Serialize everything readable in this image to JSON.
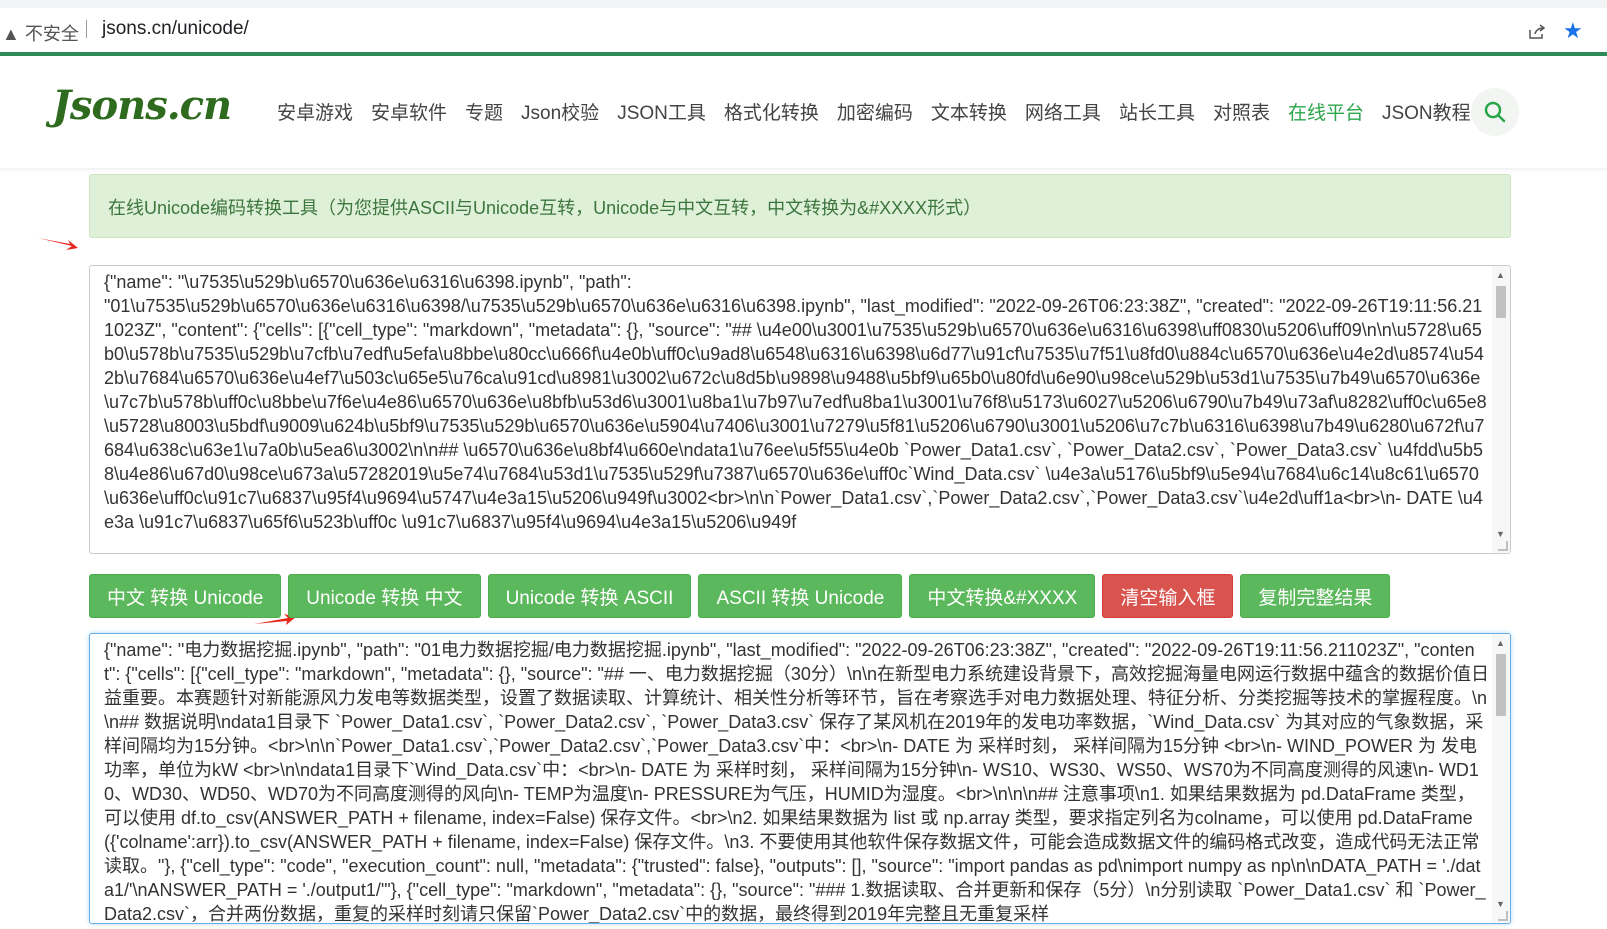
{
  "browser": {
    "security_label": "不安全",
    "url": "jsons.cn/unicode/"
  },
  "colors": {
    "brand_green": "#2e8b57",
    "button_green": "#5cb85c",
    "button_red": "#d9534f",
    "arrow_red": "#e8251b"
  },
  "site": {
    "logo": "Jsons.cn",
    "nav": [
      {
        "label": "安卓游戏",
        "active": false
      },
      {
        "label": "安卓软件",
        "active": false
      },
      {
        "label": "专题",
        "active": false
      },
      {
        "label": "Json校验",
        "active": false
      },
      {
        "label": "JSON工具",
        "active": false
      },
      {
        "label": "格式化转换",
        "active": false
      },
      {
        "label": "加密编码",
        "active": false
      },
      {
        "label": "文本转换",
        "active": false
      },
      {
        "label": "网络工具",
        "active": false
      },
      {
        "label": "站长工具",
        "active": false
      },
      {
        "label": "对照表",
        "active": false
      },
      {
        "label": "在线平台",
        "active": true
      },
      {
        "label": "JSON教程",
        "active": false
      }
    ],
    "search_icon": "search-icon"
  },
  "main": {
    "info": "在线Unicode编码转换工具（为您提供ASCII与Unicode互转，Unicode与中文互转，中文转换为&#XXXX形式）",
    "input_text": "{\"name\": \"\\u7535\\u529b\\u6570\\u636e\\u6316\\u6398.ipynb\", \"path\":\n\"01\\u7535\\u529b\\u6570\\u636e\\u6316\\u6398/\\u7535\\u529b\\u6570\\u636e\\u6316\\u6398.ipynb\", \"last_modified\": \"2022-09-26T06:23:38Z\", \"created\": \"2022-09-26T19:11:56.211023Z\", \"content\": {\"cells\": [{\"cell_type\": \"markdown\", \"metadata\": {}, \"source\": \"## \\u4e00\\u3001\\u7535\\u529b\\u6570\\u636e\\u6316\\u6398\\uff0830\\u5206\\uff09\\n\\n\\u5728\\u65b0\\u578b\\u7535\\u529b\\u7cfb\\u7edf\\u5efa\\u8bbe\\u80cc\\u666f\\u4e0b\\uff0c\\u9ad8\\u6548\\u6316\\u6398\\u6d77\\u91cf\\u7535\\u7f51\\u8fd0\\u884c\\u6570\\u636e\\u4e2d\\u8574\\u542b\\u7684\\u6570\\u636e\\u4ef7\\u503c\\u65e5\\u76ca\\u91cd\\u8981\\u3002\\u672c\\u8d5b\\u9898\\u9488\\u5bf9\\u65b0\\u80fd\\u6e90\\u98ce\\u529b\\u53d1\\u7535\\u7b49\\u6570\\u636e\\u7c7b\\u578b\\uff0c\\u8bbe\\u7f6e\\u4e86\\u6570\\u636e\\u8bfb\\u53d6\\u3001\\u8ba1\\u7b97\\u7edf\\u8ba1\\u3001\\u76f8\\u5173\\u6027\\u5206\\u6790\\u7b49\\u73af\\u8282\\uff0c\\u65e8\\u5728\\u8003\\u5bdf\\u9009\\u624b\\u5bf9\\u7535\\u529b\\u6570\\u636e\\u5904\\u7406\\u3001\\u7279\\u5f81\\u5206\\u6790\\u3001\\u5206\\u7c7b\\u6316\\u6398\\u7b49\\u6280\\u672f\\u7684\\u638c\\u63e1\\u7a0b\\u5ea6\\u3002\\n\\n## \\u6570\\u636e\\u8bf4\\u660e\\ndata1\\u76ee\\u5f55\\u4e0b `Power_Data1.csv`, `Power_Data2.csv`, `Power_Data3.csv` \\u4fdd\\u5b58\\u4e86\\u67d0\\u98ce\\u673a\\u57282019\\u5e74\\u7684\\u53d1\\u7535\\u529f\\u7387\\u6570\\u636e\\uff0c`Wind_Data.csv` \\u4e3a\\u5176\\u5bf9\\u5e94\\u7684\\u6c14\\u8c61\\u6570\\u636e\\uff0c\\u91c7\\u6837\\u95f4\\u9694\\u5747\\u4e3a15\\u5206\\u949f\\u3002<br>\\n\\n`Power_Data1.csv`,`Power_Data2.csv`,`Power_Data3.csv`\\u4e2d\\uff1a<br>\\n- DATE \\u4e3a \\u91c7\\u6837\\u65f6\\u523b\\uff0c \\u91c7\\u6837\\u95f4\\u9694\\u4e3a15\\u5206\\u949f",
    "output_text": "{\"name\": \"电力数据挖掘.ipynb\", \"path\": \"01电力数据挖掘/电力数据挖掘.ipynb\", \"last_modified\": \"2022-09-26T06:23:38Z\", \"created\": \"2022-09-26T19:11:56.211023Z\", \"content\": {\"cells\": [{\"cell_type\": \"markdown\", \"metadata\": {}, \"source\": \"## 一、电力数据挖掘（30分）\\n\\n在新型电力系统建设背景下，高效挖掘海量电网运行数据中蕴含的数据价值日益重要。本赛题针对新能源风力发电等数据类型，设置了数据读取、计算统计、相关性分析等环节，旨在考察选手对电力数据处理、特征分析、分类挖掘等技术的掌握程度。\\n\\n## 数据说明\\ndata1目录下 `Power_Data1.csv`, `Power_Data2.csv`, `Power_Data3.csv` 保存了某风机在2019年的发电功率数据，`Wind_Data.csv` 为其对应的气象数据，采样间隔均为15分钟。<br>\\n\\n`Power_Data1.csv`,`Power_Data2.csv`,`Power_Data3.csv`中：<br>\\n- DATE 为 采样时刻， 采样间隔为15分钟 <br>\\n- WIND_POWER 为 发电功率，单位为kW <br>\\n\\ndata1目录下`Wind_Data.csv`中：<br>\\n- DATE 为 采样时刻， 采样间隔为15分钟\\n- WS10、WS30、WS50、WS70为不同高度测得的风速\\n- WD10、WD30、WD50、WD70为不同高度测得的风向\\n- TEMP为温度\\n- PRESSURE为气压，HUMID为湿度。<br>\\n\\n\\n## 注意事项\\n1. 如果结果数据为 pd.DataFrame 类型，可以使用 df.to_csv(ANSWER_PATH + filename, index=False) 保存文件。<br>\\n2. 如果结果数据为 list 或 np.array 类型，要求指定列名为colname，可以使用 pd.DataFrame({'colname':arr}).to_csv(ANSWER_PATH + filename, index=False) 保存文件。\\n3. 不要使用其他软件保存数据文件，可能会造成数据文件的编码格式改变，造成代码无法正常读取。\"}, {\"cell_type\": \"code\", \"execution_count\": null, \"metadata\": {\"trusted\": false}, \"outputs\": [], \"source\": \"import pandas as pd\\nimport numpy as np\\n\\nDATA_PATH = './data1/'\\nANSWER_PATH = './output1/'\"}, {\"cell_type\": \"markdown\", \"metadata\": {}, \"source\": \"### 1.数据读取、合并更新和保存（5分）\\n分别读取 `Power_Data1.csv` 和 `Power_Data2.csv`，合并两份数据，重复的采样时刻请只保留`Power_Data2.csv`中的数据，最终得到2019年完整且无重复采样",
    "buttons": [
      {
        "label": "中文 转换 Unicode",
        "style": "green"
      },
      {
        "label": "Unicode 转换 中文",
        "style": "green"
      },
      {
        "label": "Unicode 转换 ASCII",
        "style": "green"
      },
      {
        "label": "ASCII 转换 Unicode",
        "style": "green"
      },
      {
        "label": "中文转换&#XXXX",
        "style": "green"
      },
      {
        "label": "清空输入框",
        "style": "red"
      },
      {
        "label": "复制完整结果",
        "style": "green"
      }
    ]
  }
}
